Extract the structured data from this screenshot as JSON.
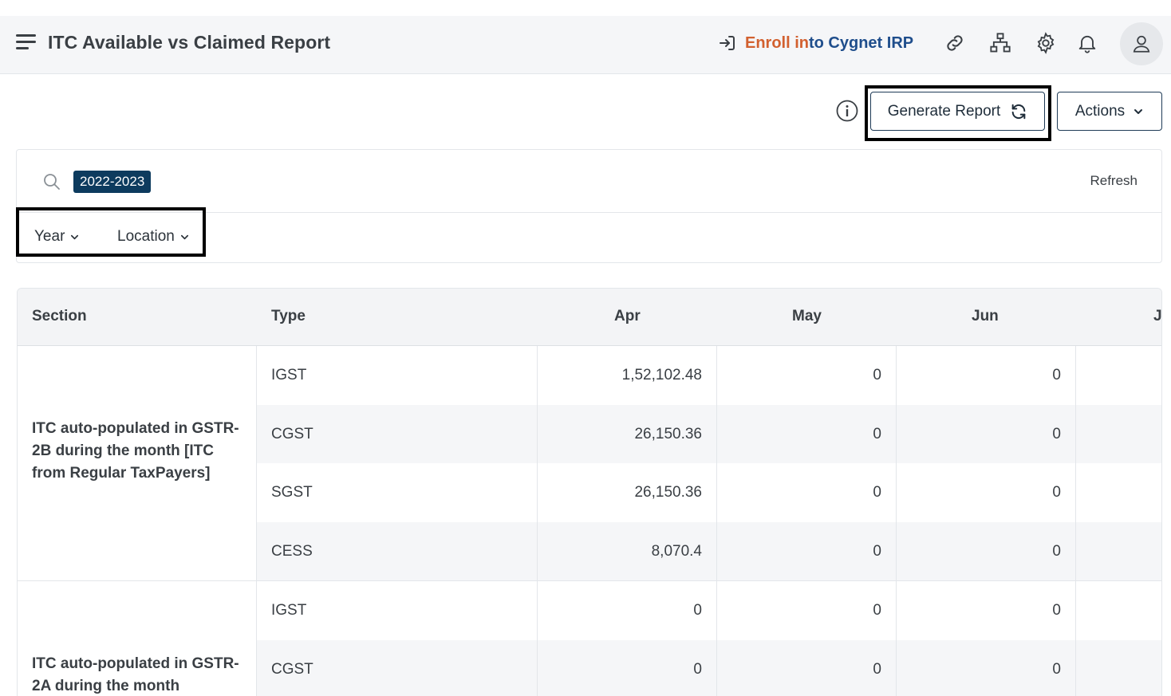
{
  "header": {
    "title": "ITC Available vs Claimed Report",
    "enroll_part1": "Enroll in",
    "enroll_part2": "to Cygnet IRP",
    "icons": [
      "menu-icon",
      "login-icon",
      "link-icon",
      "sitemap-icon",
      "gear-icon",
      "bell-icon",
      "user-icon"
    ]
  },
  "toolbar": {
    "generate_label": "Generate Report",
    "actions_label": "Actions"
  },
  "filters": {
    "chip": "2022-2023",
    "refresh_label": "Refresh",
    "year_label": "Year",
    "location_label": "Location"
  },
  "table": {
    "columns": [
      "Section",
      "Type",
      "Apr",
      "May",
      "Jun",
      "J"
    ],
    "sections": [
      {
        "title": "ITC auto-populated in GSTR-2B during the month [ITC from Regular TaxPayers]",
        "rows": [
          {
            "type": "IGST",
            "apr": "1,52,102.48",
            "may": "0",
            "jun": "0"
          },
          {
            "type": "CGST",
            "apr": "26,150.36",
            "may": "0",
            "jun": "0"
          },
          {
            "type": "SGST",
            "apr": "26,150.36",
            "may": "0",
            "jun": "0"
          },
          {
            "type": "CESS",
            "apr": "8,070.4",
            "may": "0",
            "jun": "0"
          }
        ]
      },
      {
        "title": "ITC auto-populated in GSTR-2A during the month",
        "rows": [
          {
            "type": "IGST",
            "apr": "0",
            "may": "0",
            "jun": "0"
          },
          {
            "type": "CGST",
            "apr": "0",
            "may": "0",
            "jun": "0"
          }
        ]
      }
    ]
  },
  "colors": {
    "brand_dark": "#0d3b5e",
    "enroll_orange": "#d2602f",
    "enroll_blue": "#1f4e8c"
  }
}
